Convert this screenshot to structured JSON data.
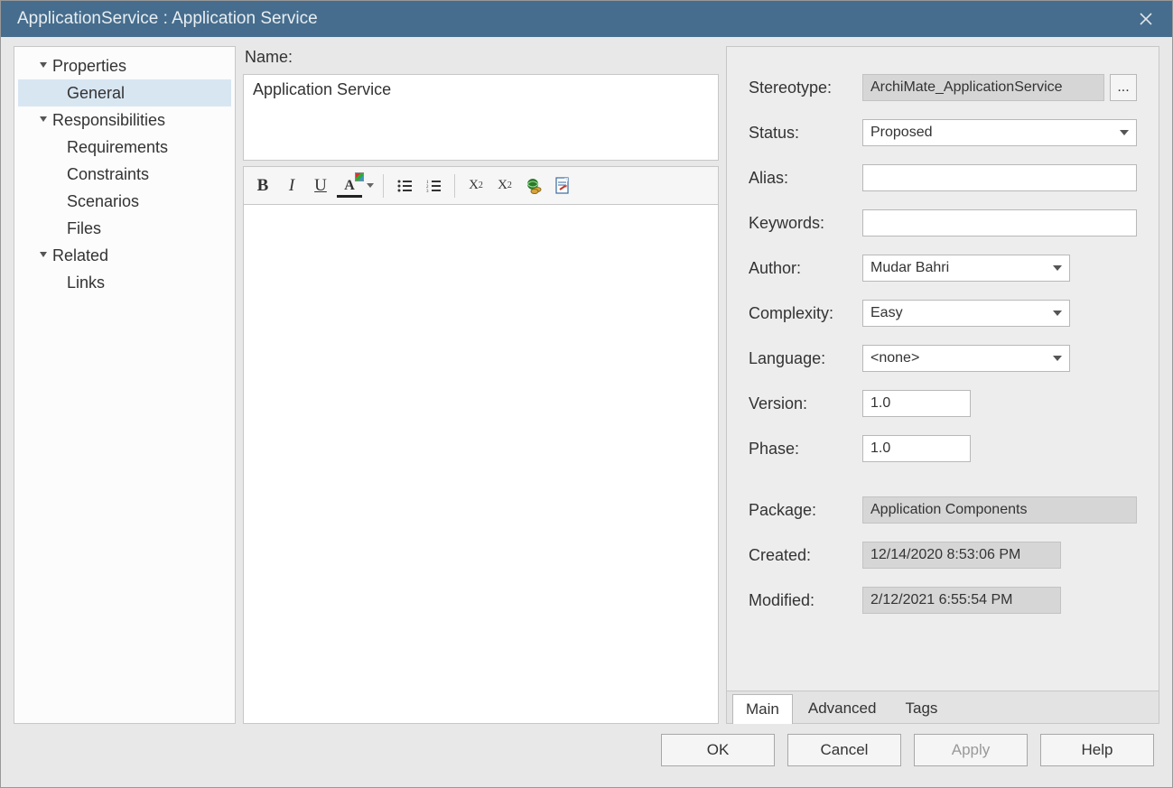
{
  "titlebar": {
    "title": "ApplicationService : Application Service"
  },
  "sidebar": {
    "properties": "Properties",
    "general": "General",
    "responsibilities": "Responsibilities",
    "requirements": "Requirements",
    "constraints": "Constraints",
    "scenarios": "Scenarios",
    "files": "Files",
    "related": "Related",
    "links": "Links"
  },
  "center": {
    "name_label": "Name:",
    "name_value": "Application Service"
  },
  "right": {
    "labels": {
      "stereotype": "Stereotype:",
      "status": "Status:",
      "alias": "Alias:",
      "keywords": "Keywords:",
      "author": "Author:",
      "complexity": "Complexity:",
      "language": "Language:",
      "version": "Version:",
      "phase": "Phase:",
      "package": "Package:",
      "created": "Created:",
      "modified": "Modified:"
    },
    "values": {
      "stereotype": "ArchiMate_ApplicationService",
      "status": "Proposed",
      "alias": "",
      "keywords": "",
      "author": "Mudar Bahri",
      "complexity": "Easy",
      "language": "<none>",
      "version": "1.0",
      "phase": "1.0",
      "package": "Application Components",
      "created": "12/14/2020 8:53:06 PM",
      "modified": "2/12/2021 6:55:54 PM"
    },
    "ellipsis": "...",
    "tabs": {
      "main": "Main",
      "advanced": "Advanced",
      "tags": "Tags"
    }
  },
  "footer": {
    "ok": "OK",
    "cancel": "Cancel",
    "apply": "Apply",
    "help": "Help"
  }
}
